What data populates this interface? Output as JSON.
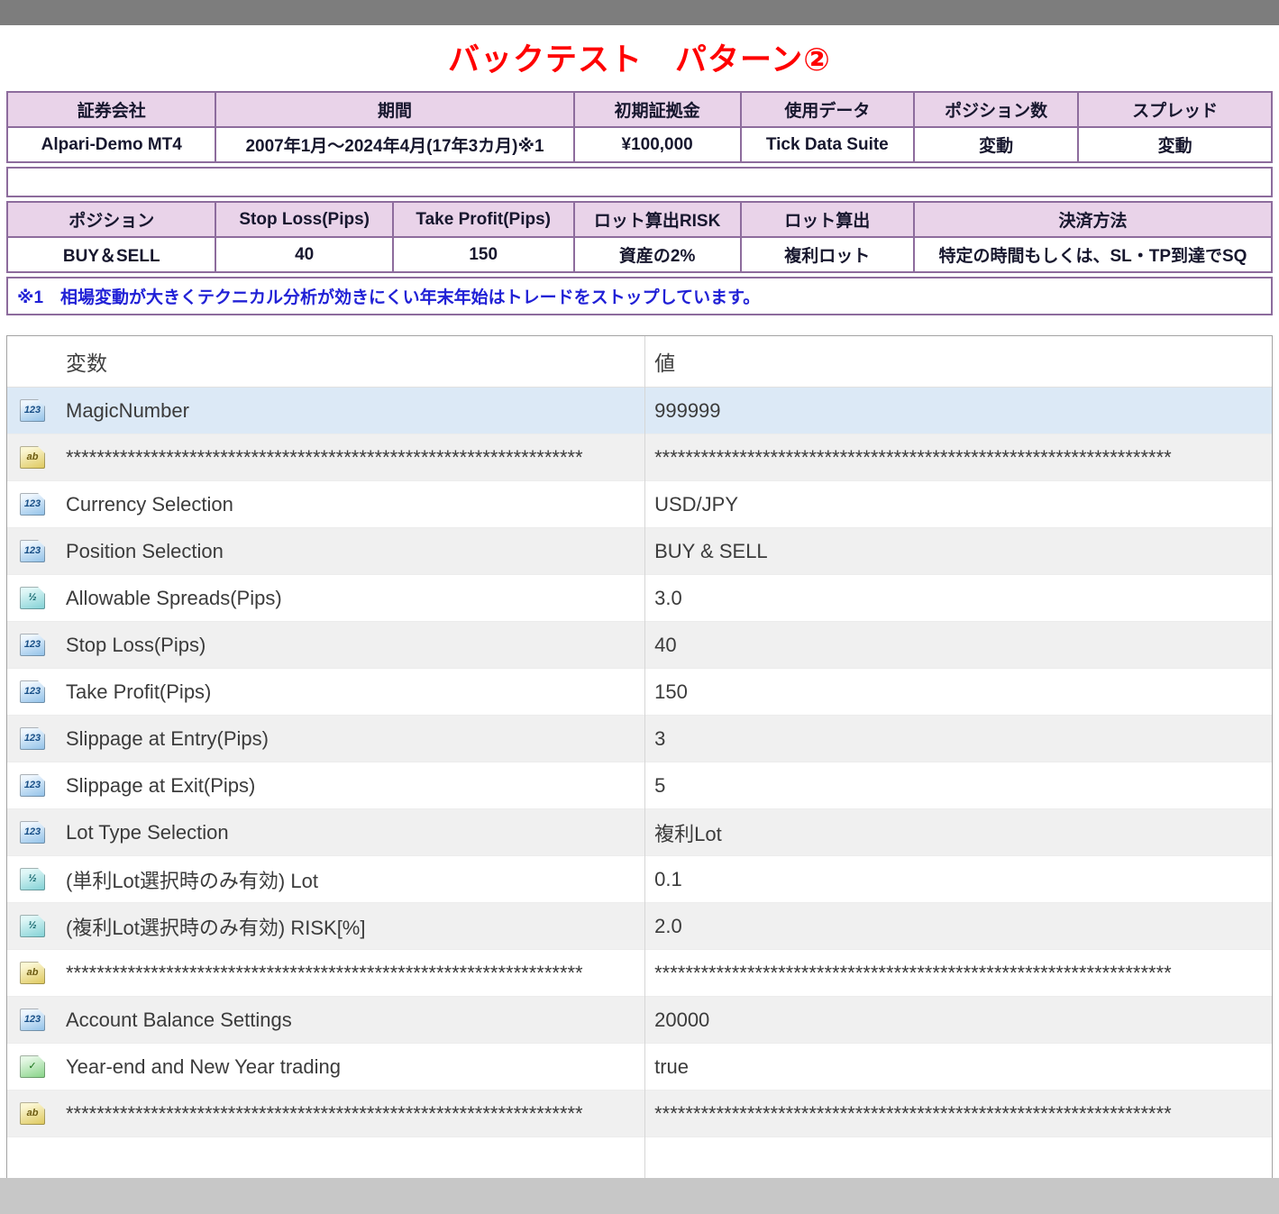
{
  "title": "バックテスト　パターン②",
  "colors": {
    "title_text": "#ff0000",
    "table_border": "#8d6c9d",
    "table_header_bg": "#e9d3e9",
    "note_text": "#2121d6",
    "selected_row_bg": "#dce9f6"
  },
  "summary_table": {
    "headers": [
      "証券会社",
      "期間",
      "初期証拠金",
      "使用データ",
      "ポジション数",
      "スプレッド"
    ],
    "values": [
      "Alpari-Demo MT4",
      "2007年1月～2024年4月(17年3カ月)※1",
      "¥100,000",
      "Tick Data Suite",
      "変動",
      "変動"
    ]
  },
  "settings_table": {
    "headers": [
      "ポジション",
      "Stop Loss(Pips)",
      "Take Profit(Pips)",
      "ロット算出RISK",
      "ロット算出",
      "決済方法"
    ],
    "values": [
      "BUY＆SELL",
      "40",
      "150",
      "資産の2%",
      "複利ロット",
      "特定の時間もしくは、SL・TP到達でSQ"
    ]
  },
  "note": "※1　相場変動が大きくテクニカル分析が効きにくい年末年始はトレードをストップしています。",
  "param_table": {
    "col_variable": "変数",
    "col_value": "値",
    "rows": [
      {
        "icon": "123",
        "label": "MagicNumber",
        "value": "999999",
        "selected": true
      },
      {
        "icon": "ab",
        "label": "*******************************************************************",
        "value": "*******************************************************************"
      },
      {
        "icon": "123",
        "label": "Currency Selection",
        "value": "USD/JPY"
      },
      {
        "icon": "123",
        "label": "Position Selection",
        "value": "BUY & SELL"
      },
      {
        "icon": "half",
        "label": "Allowable Spreads(Pips)",
        "value": "3.0"
      },
      {
        "icon": "123",
        "label": "Stop Loss(Pips)",
        "value": "40"
      },
      {
        "icon": "123",
        "label": "Take Profit(Pips)",
        "value": "150"
      },
      {
        "icon": "123",
        "label": "Slippage at Entry(Pips)",
        "value": "3"
      },
      {
        "icon": "123",
        "label": "Slippage at Exit(Pips)",
        "value": "5"
      },
      {
        "icon": "123",
        "label": "Lot Type Selection",
        "value": "複利Lot"
      },
      {
        "icon": "half",
        "label": "(単利Lot選択時のみ有効) Lot",
        "value": "0.1"
      },
      {
        "icon": "half",
        "label": "(複利Lot選択時のみ有効) RISK[%]",
        "value": "2.0"
      },
      {
        "icon": "ab",
        "label": "*******************************************************************",
        "value": "*******************************************************************"
      },
      {
        "icon": "123",
        "label": "Account Balance Settings",
        "value": "20000"
      },
      {
        "icon": "check",
        "label": "Year-end and New Year trading",
        "value": "true"
      },
      {
        "icon": "ab",
        "label": "*******************************************************************",
        "value": "*******************************************************************"
      }
    ]
  }
}
